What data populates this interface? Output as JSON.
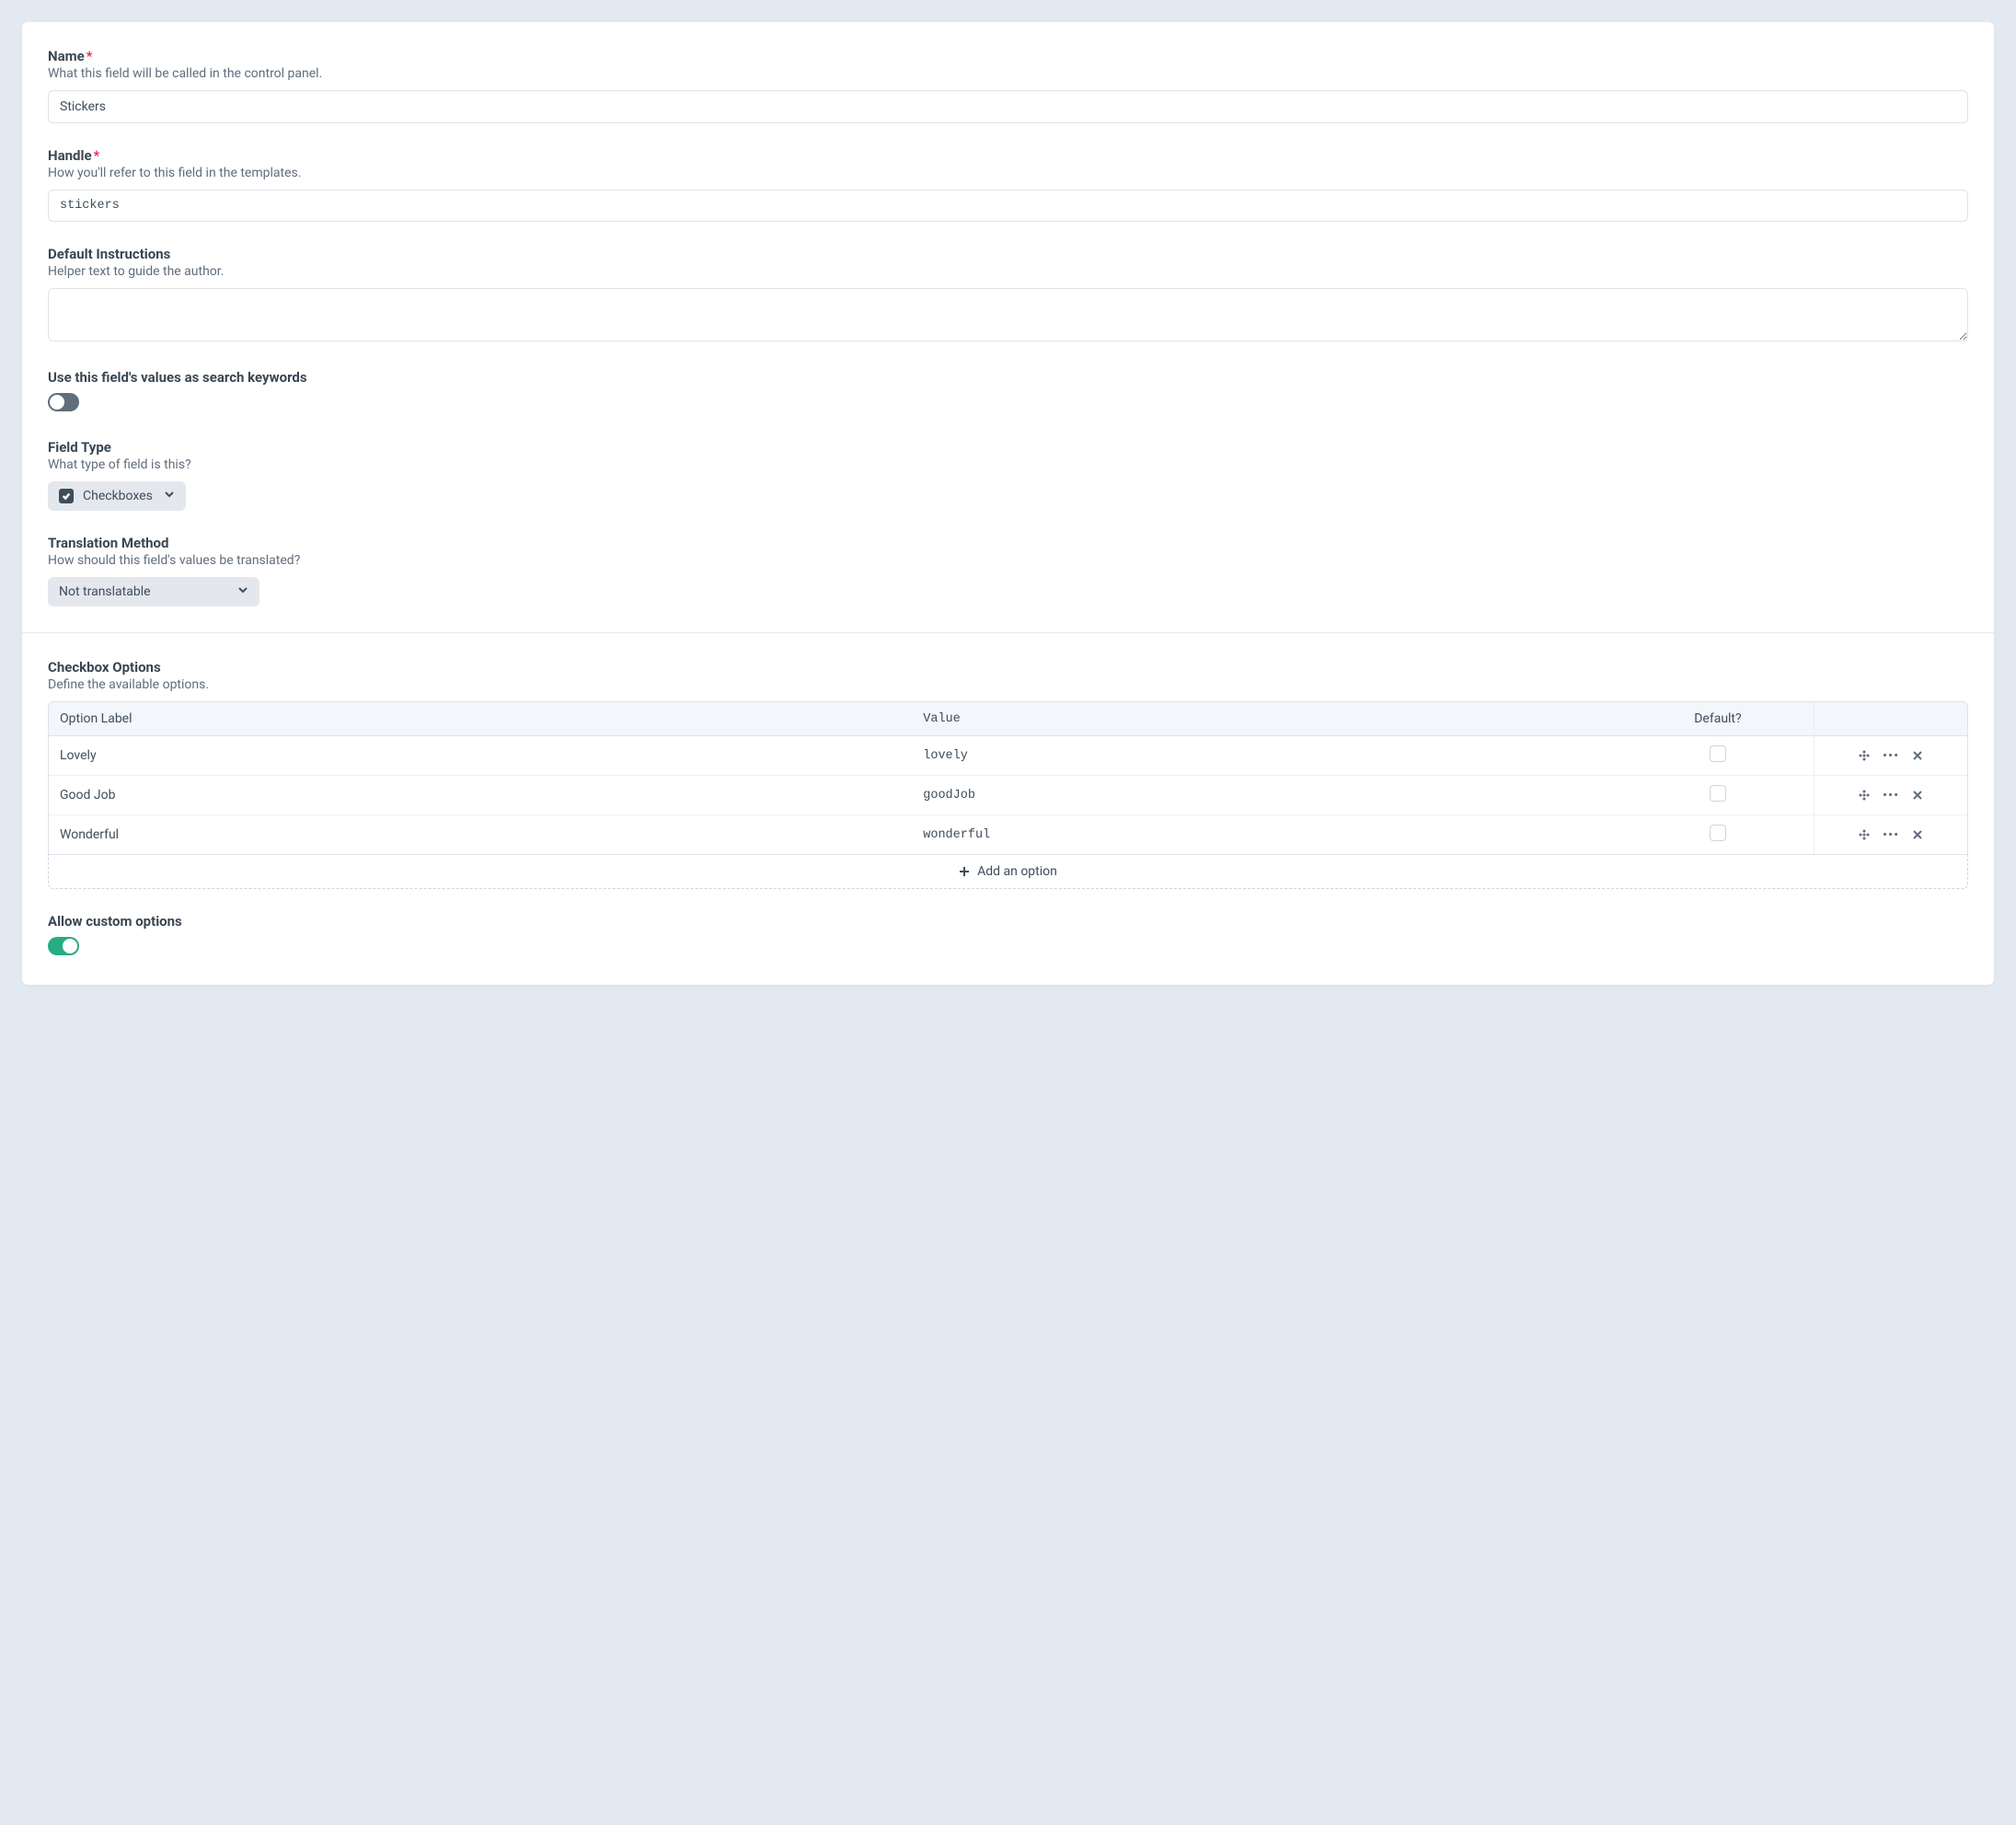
{
  "fields": {
    "name": {
      "label": "Name",
      "help": "What this field will be called in the control panel.",
      "value": "Stickers",
      "required": true
    },
    "handle": {
      "label": "Handle",
      "help": "How you'll refer to this field in the templates.",
      "value": "stickers",
      "required": true
    },
    "instructions": {
      "label": "Default Instructions",
      "help": "Helper text to guide the author.",
      "value": ""
    },
    "searchable": {
      "label": "Use this field's values as search keywords",
      "on": false
    },
    "fieldType": {
      "label": "Field Type",
      "help": "What type of field is this?",
      "value": "Checkboxes"
    },
    "translation": {
      "label": "Translation Method",
      "help": "How should this field's values be translated?",
      "value": "Not translatable"
    },
    "checkboxOptions": {
      "label": "Checkbox Options",
      "help": "Define the available options.",
      "columns": {
        "label": "Option Label",
        "value": "Value",
        "default": "Default?"
      },
      "rows": [
        {
          "label": "Lovely",
          "value": "lovely",
          "default": false
        },
        {
          "label": "Good Job",
          "value": "goodJob",
          "default": false
        },
        {
          "label": "Wonderful",
          "value": "wonderful",
          "default": false
        }
      ],
      "addLabel": "Add an option"
    },
    "allowCustom": {
      "label": "Allow custom options",
      "on": true
    }
  },
  "requiredMark": "*"
}
